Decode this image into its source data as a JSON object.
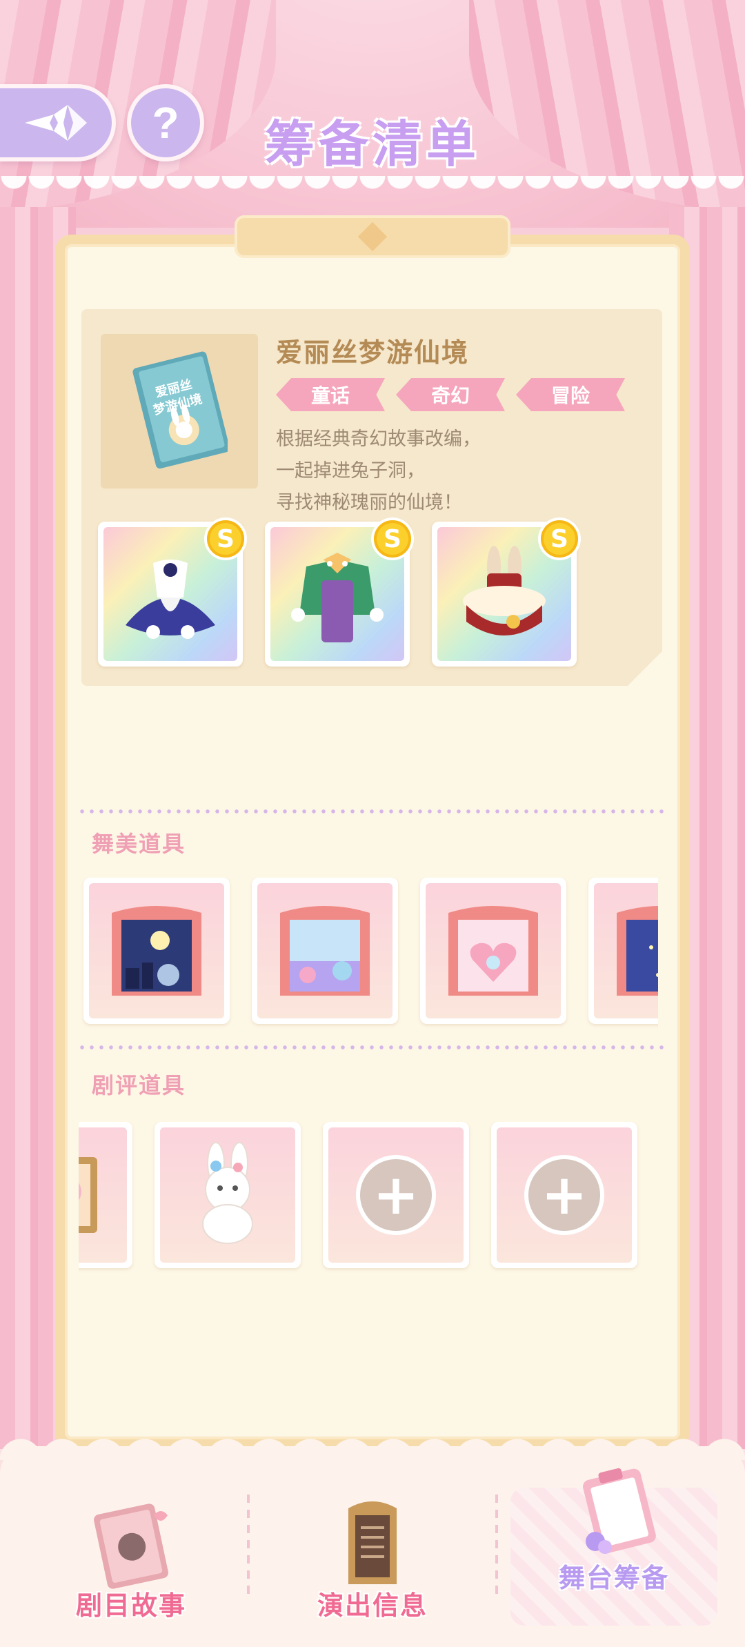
{
  "header": {
    "title": "筹备清单",
    "help_label": "?"
  },
  "story": {
    "name": "爱丽丝梦游仙境",
    "cover_title": "爱丽丝梦游仙境",
    "tags": [
      "童话",
      "奇幻",
      "冒险"
    ],
    "description": [
      "根据经典奇幻故事改编，",
      "一起掉进兔子洞，",
      "寻找神秘瑰丽的仙境！"
    ],
    "outfits": [
      {
        "icon": "blue-dress-icon",
        "badge": "S"
      },
      {
        "icon": "green-suit-icon",
        "badge": "S"
      },
      {
        "icon": "rabbit-hat-icon",
        "badge": "S"
      }
    ]
  },
  "sections": {
    "stage_props": {
      "title": "舞美道具",
      "items": [
        "night-stage-icon",
        "garden-stage-icon",
        "heart-stage-icon",
        "star-stage-icon"
      ]
    },
    "review_props": {
      "title": "剧评道具",
      "items": [
        {
          "icon": "portrait-frame-icon",
          "add": ""
        },
        {
          "icon": "bunny-plush-icon",
          "add": ""
        },
        {
          "icon": "add-icon",
          "add": "+"
        },
        {
          "icon": "add-icon",
          "add": "+"
        }
      ]
    }
  },
  "bottom_nav": [
    {
      "label": "剧目故事",
      "icon": "storybook-icon",
      "active": false
    },
    {
      "label": "演出信息",
      "icon": "notice-board-icon",
      "active": false
    },
    {
      "label": "舞台筹备",
      "icon": "clipboard-icon",
      "active": true
    }
  ],
  "colors": {
    "accent_purple": "#c89ef0",
    "tag_pink": "#f5a6bc",
    "title_brown": "#b48a55",
    "nav_pink": "#f06b93"
  }
}
